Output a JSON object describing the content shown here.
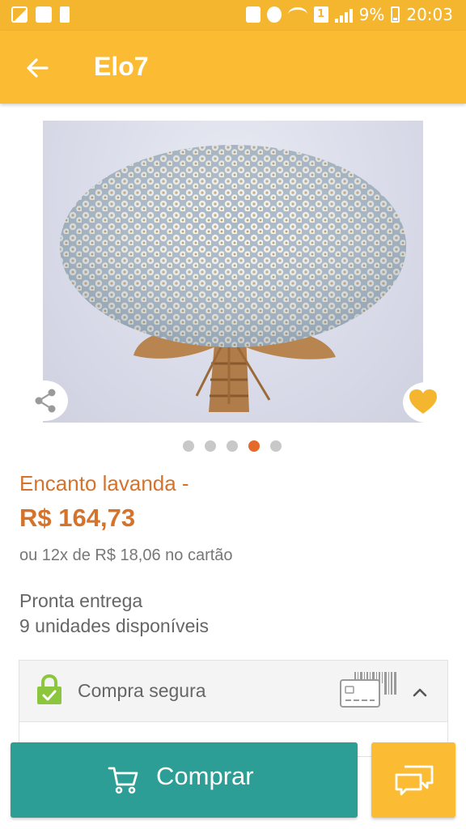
{
  "status_bar": {
    "battery_percent": "9%",
    "time": "20:03",
    "sim_label": "1",
    "icons": [
      "image-icon",
      "app-icon",
      "alert-icon",
      "lock-icon",
      "alarm-icon",
      "wifi-icon",
      "sim-icon",
      "signal-icon",
      "battery-icon"
    ]
  },
  "app_bar": {
    "title": "Elo7",
    "back_icon": "arrow-left-icon",
    "background": "#fbbc34"
  },
  "product": {
    "image_icon": "flower-bouquet-image",
    "title": "Encanto lavanda -",
    "price": "R$ 164,73",
    "installments": "ou 12x de R$ 18,06 no cartão",
    "availability": "Pronta entrega",
    "units": "9 unidades disponíveis",
    "accent_color": "#d4732c"
  },
  "carousel": {
    "count": 5,
    "active_index": 3
  },
  "secure_purchase": {
    "label": "Compra segura",
    "lock_color": "#8cc63f"
  },
  "actions": {
    "buy_label": "Comprar",
    "buy_color": "#2c9e95",
    "chat_color": "#fbbc34"
  }
}
